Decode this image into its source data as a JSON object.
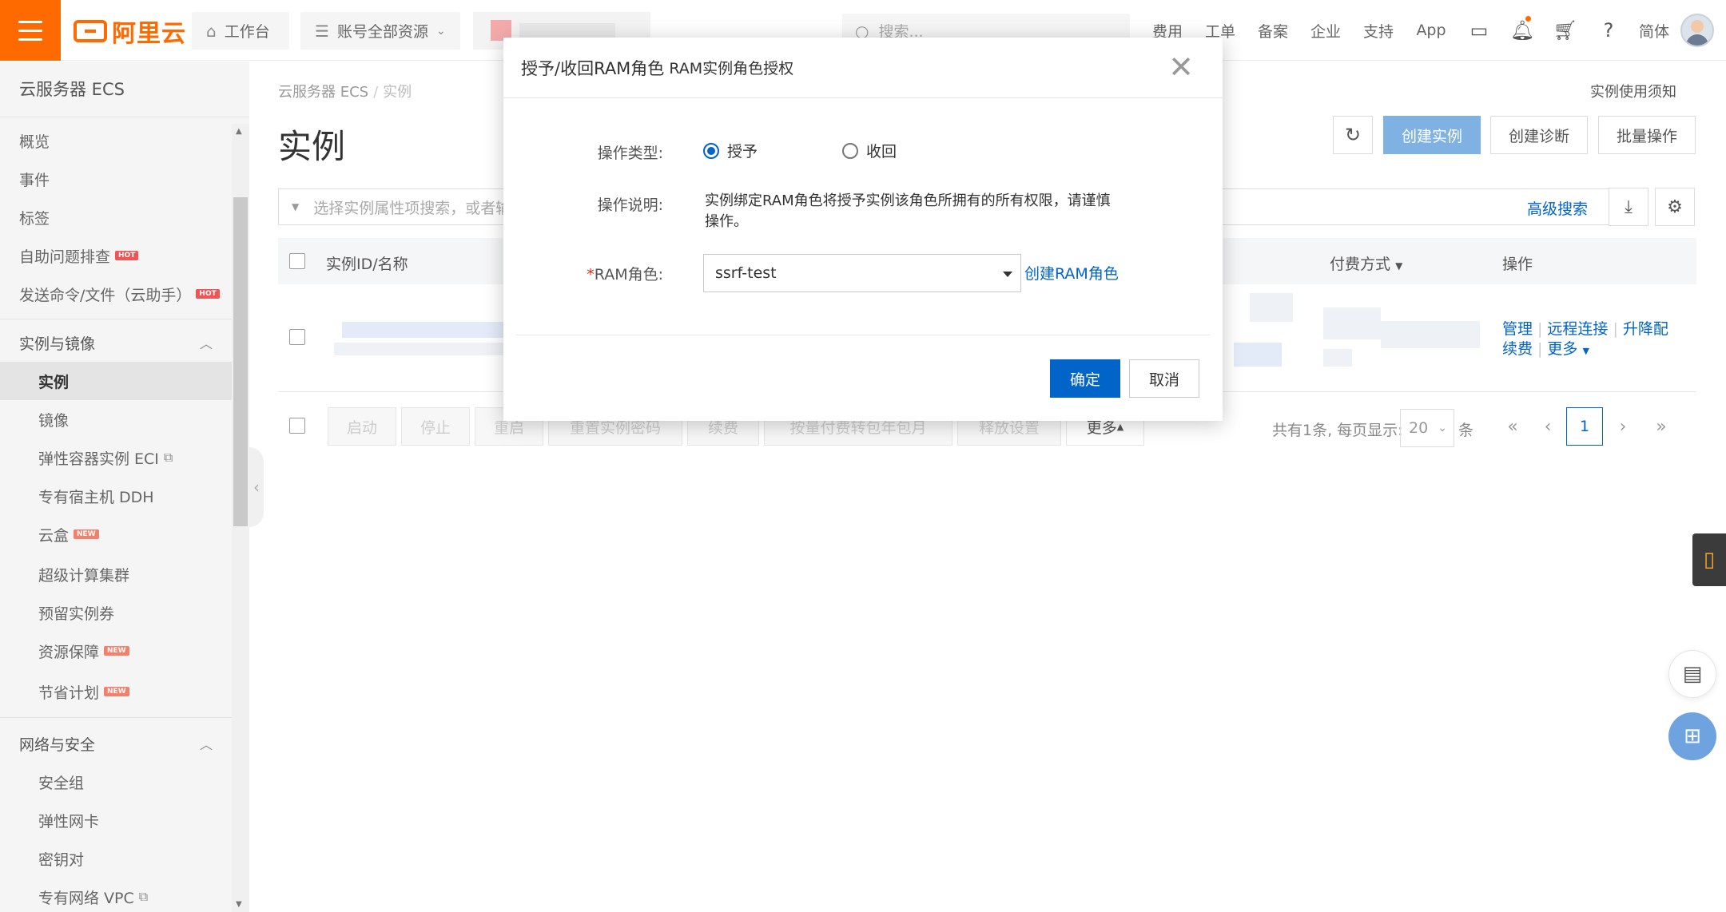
{
  "topbar": {
    "logo_text": "阿里云",
    "workbench": "工作台",
    "resources": "账号全部资源",
    "search_placeholder": "搜索...",
    "links": [
      "费用",
      "工单",
      "备案",
      "企业",
      "支持",
      "App"
    ],
    "lang": "简体"
  },
  "sidebar": {
    "title": "云服务器 ECS",
    "items_top": [
      "概览",
      "事件",
      "标签",
      "自助问题排查",
      "发送命令/文件（云助手）"
    ],
    "group_instances": "实例与镜像",
    "instances_items": [
      "实例",
      "镜像",
      "弹性容器实例 ECI",
      "专有宿主机 DDH",
      "云盒",
      "超级计算集群",
      "预留实例券",
      "资源保障",
      "节省计划"
    ],
    "group_network": "网络与安全",
    "network_items": [
      "安全组",
      "弹性网卡",
      "密钥对",
      "专有网络 VPC"
    ],
    "badge_hot": "HOT",
    "badge_new": "NEW"
  },
  "breadcrumb": {
    "root": "云服务器 ECS",
    "sep": "/",
    "current": "实例"
  },
  "page": {
    "title": "实例",
    "notice": "实例使用须知",
    "btn_create": "创建实例",
    "btn_diagnose": "创建诊断",
    "btn_batch": "批量操作",
    "filter_placeholder": "选择实例属性项搜索，或者输",
    "adv_search": "高级搜索"
  },
  "table": {
    "col_id": "实例ID/名称",
    "col_billing": "付费方式",
    "col_ops": "操作",
    "row_actions": [
      "管理",
      "远程连接",
      "升降配",
      "续费",
      "更多"
    ]
  },
  "bottom": {
    "buttons": [
      "启动",
      "停止",
      "重启",
      "重置实例密码",
      "续费",
      "按量付费转包年包月",
      "释放设置"
    ],
    "more": "更多",
    "total": "共有1条, 每页显示:",
    "page_size": "20",
    "unit": "条",
    "current_page": "1"
  },
  "modal": {
    "title_main": "授予/收回RAM角色",
    "title_sub": "RAM实例角色授权",
    "label_type": "操作类型:",
    "opt_grant": "授予",
    "opt_revoke": "收回",
    "label_desc": "操作说明:",
    "desc_text": "实例绑定RAM角色将授予实例该角色所拥有的所有权限，请谨慎操作。",
    "label_role": "RAM角色:",
    "role_value": "ssrf-test",
    "create_role": "创建RAM角色",
    "ok": "确定",
    "cancel": "取消"
  },
  "colors": {
    "brand": "#ff6a00",
    "primary": "#0064c8"
  }
}
